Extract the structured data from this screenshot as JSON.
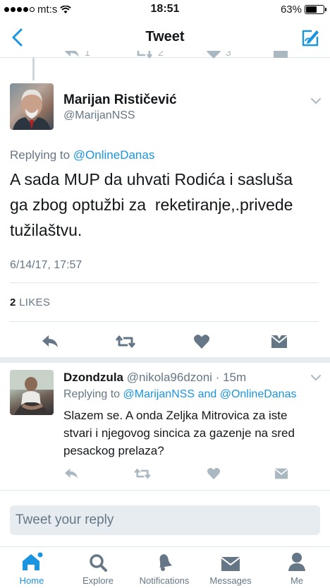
{
  "status_bar": {
    "carrier": "mt:s",
    "time": "18:51",
    "battery": "63%",
    "battery_level": 0.63
  },
  "nav": {
    "title": "Tweet",
    "back_icon": "chevron-left-icon",
    "compose_icon": "compose-icon"
  },
  "prior_tweet_actions": {
    "reply_count": "1",
    "retweet_count": "2",
    "like_count": "3"
  },
  "main_tweet": {
    "author_name": "Marijan Rističević",
    "author_handle": "@MarijanNSS",
    "replying_to_prefix": "Replying to",
    "replying_to": "@OnlineDanas",
    "text_lines": [
      "A sada MUP da uhvati Rodića i sasluša",
      "ga zbog optužbi za  reketiranje,.privede",
      "tužilaštvu."
    ],
    "timestamp": "6/14/17, 17:57",
    "likes_count": "2",
    "likes_label": "LIKES"
  },
  "reply_tweet": {
    "author_name": "Dzondzula",
    "author_handle": "@nikola96dzoni",
    "time_ago": "15m",
    "replying_to_prefix": "Replying to",
    "replying_to_1": "@MarijanNSS",
    "replying_to_and": "and",
    "replying_to_2": "@OnlineDanas",
    "text": "Slazem se. A onda Zeljka Mitrovica za iste stvari i njegovog sincica za gazenje na sred pesackog prelaza?"
  },
  "composer": {
    "placeholder": "Tweet your reply"
  },
  "tabs": [
    {
      "label": "Home",
      "icon": "home-icon",
      "active": true
    },
    {
      "label": "Explore",
      "icon": "search-icon",
      "active": false
    },
    {
      "label": "Notifications",
      "icon": "bell-icon",
      "active": false
    },
    {
      "label": "Messages",
      "icon": "envelope-icon",
      "active": false
    },
    {
      "label": "Me",
      "icon": "person-icon",
      "active": false
    }
  ],
  "colors": {
    "accent": "#1b95e0",
    "icon_gray": "#657786",
    "light_gray": "#aab8c2",
    "divider": "#e1e8ed",
    "background_gray": "#e6ecf0"
  }
}
